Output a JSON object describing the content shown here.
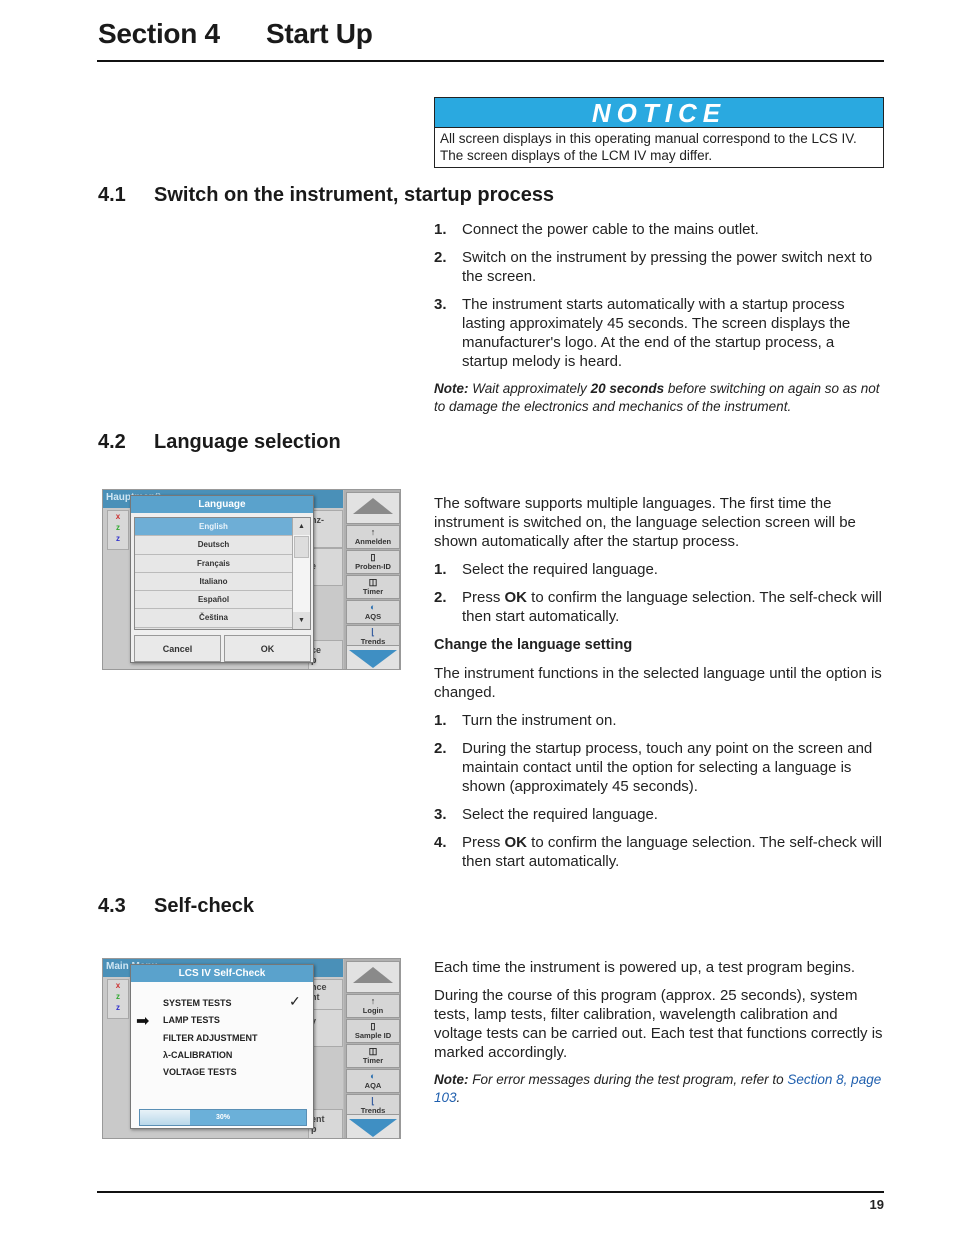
{
  "header": {
    "section_number": "Section 4",
    "section_title": "Start Up"
  },
  "notice": {
    "title": "NOTICE",
    "lines": [
      "All screen displays in this operating manual correspond to the LCS IV.",
      "The screen displays of the LCM IV may differ."
    ]
  },
  "s41": {
    "number": "4.1",
    "title": "Switch on the instrument, startup process",
    "steps": [
      {
        "n": "1.",
        "text": "Connect the power cable to the mains outlet."
      },
      {
        "n": "2.",
        "text": "Switch on the instrument by pressing the power switch next to the screen."
      },
      {
        "n": "3.",
        "text": "The instrument starts automatically with a startup process lasting approximately 45 seconds. The screen displays the manufacturer's logo. At the end of the startup process, a startup melody is heard."
      }
    ],
    "note_label": "Note:",
    "note_pre": " Wait approximately ",
    "note_bold": "20 seconds",
    "note_post": " before switching on again so as not to damage the electronics and mechanics of the instrument."
  },
  "s42": {
    "number": "4.2",
    "title": "Language selection",
    "intro": "The software supports multiple languages. The first time the instrument is switched on, the language selection screen will be shown automatically after the startup process.",
    "steps": [
      {
        "n": "1.",
        "pre": "Select the required language.",
        "bold": "",
        "post": ""
      },
      {
        "n": "2.",
        "pre": "Press ",
        "bold": "OK",
        "post": " to confirm the language selection. The self-check will then start automatically."
      }
    ],
    "sub_heading": "Change the language setting",
    "sub_intro": "The instrument functions in the selected language until the option is changed.",
    "sub_steps": [
      {
        "n": "1.",
        "pre": "Turn the instrument on.",
        "bold": "",
        "post": ""
      },
      {
        "n": "2.",
        "pre": "During the startup process, touch any point on the screen and maintain contact until the option for selecting a language is shown (approximately 45 seconds).",
        "bold": "",
        "post": ""
      },
      {
        "n": "3.",
        "pre": "Select the required language.",
        "bold": "",
        "post": ""
      },
      {
        "n": "4.",
        "pre": "Press ",
        "bold": "OK",
        "post": " to confirm the language selection. The self-check will then start automatically."
      }
    ],
    "screen": {
      "topbar": "Hauptmenü",
      "dialog_title": "Language",
      "languages": [
        "English",
        "Deutsch",
        "Français",
        "Italiano",
        "Español",
        "Čeština"
      ],
      "selected": "English",
      "cancel": "Cancel",
      "ok": "OK",
      "side_buttons": [
        {
          "icon": "↑",
          "label": "Anmelden"
        },
        {
          "icon": "▯",
          "label": "Proben-ID"
        },
        {
          "icon": "◫",
          "label": "Timer"
        },
        {
          "icon": "◐",
          "label": "AQS"
        },
        {
          "icon": "⌊",
          "label": "Trends"
        }
      ],
      "bg_fragments": [
        "nz-",
        "e",
        "ce",
        "p"
      ]
    }
  },
  "s43": {
    "number": "4.3",
    "title": "Self-check",
    "para1": "Each time the instrument is powered up, a test program begins.",
    "para2": "During the course of this program (approx. 25 seconds), system tests, lamp tests, filter calibration, wavelength calibration and voltage tests can be carried out. Each test that functions correctly is marked accordingly.",
    "note_label": "Note:",
    "note_pre": " For error messages during the test program, refer to ",
    "note_link": "Section 8, page 103",
    "note_post": ".",
    "screen": {
      "topbar": "Main Menu",
      "dialog_title": "LCS IV  Self-Check",
      "tests": [
        "SYSTEM TESTS",
        "LAMP TESTS",
        "FILTER ADJUSTMENT",
        "λ-CALIBRATION",
        "VOLTAGE TESTS"
      ],
      "checked": "SYSTEM TESTS",
      "current": "LAMP TESTS",
      "progress_percent": 30,
      "progress_label": "30%",
      "side_buttons": [
        {
          "icon": "↑",
          "label": "Login"
        },
        {
          "icon": "▯",
          "label": "Sample ID"
        },
        {
          "icon": "◫",
          "label": "Timer"
        },
        {
          "icon": "◐",
          "label": "AQA"
        },
        {
          "icon": "⌊",
          "label": "Trends"
        }
      ],
      "bg_fragments": [
        "nce",
        "nt",
        "y",
        "ent",
        "p"
      ]
    }
  },
  "footer": {
    "page_number": "19"
  }
}
